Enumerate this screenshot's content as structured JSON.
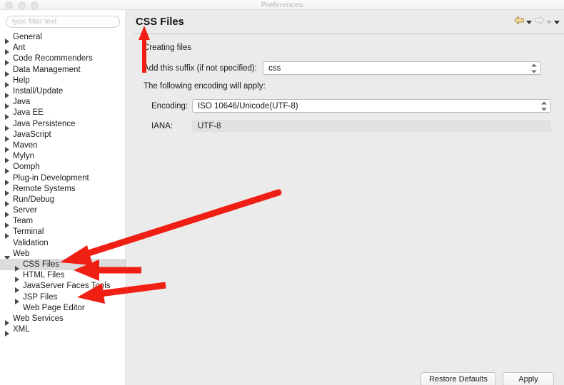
{
  "window": {
    "title": "Preferences",
    "traffic_lights": [
      "close-button",
      "minimize-button",
      "zoom-button"
    ]
  },
  "sidebar": {
    "filter": {
      "placeholder": "type filter text",
      "value": ""
    },
    "items": [
      {
        "label": "General",
        "level": 1,
        "twisty": "collapsed",
        "selected": false
      },
      {
        "label": "Ant",
        "level": 1,
        "twisty": "collapsed",
        "selected": false
      },
      {
        "label": "Code Recommenders",
        "level": 1,
        "twisty": "collapsed",
        "selected": false
      },
      {
        "label": "Data Management",
        "level": 1,
        "twisty": "collapsed",
        "selected": false
      },
      {
        "label": "Help",
        "level": 1,
        "twisty": "collapsed",
        "selected": false
      },
      {
        "label": "Install/Update",
        "level": 1,
        "twisty": "collapsed",
        "selected": false
      },
      {
        "label": "Java",
        "level": 1,
        "twisty": "collapsed",
        "selected": false
      },
      {
        "label": "Java EE",
        "level": 1,
        "twisty": "collapsed",
        "selected": false
      },
      {
        "label": "Java Persistence",
        "level": 1,
        "twisty": "collapsed",
        "selected": false
      },
      {
        "label": "JavaScript",
        "level": 1,
        "twisty": "collapsed",
        "selected": false
      },
      {
        "label": "Maven",
        "level": 1,
        "twisty": "collapsed",
        "selected": false
      },
      {
        "label": "Mylyn",
        "level": 1,
        "twisty": "collapsed",
        "selected": false
      },
      {
        "label": "Oomph",
        "level": 1,
        "twisty": "collapsed",
        "selected": false
      },
      {
        "label": "Plug-in Development",
        "level": 1,
        "twisty": "collapsed",
        "selected": false
      },
      {
        "label": "Remote Systems",
        "level": 1,
        "twisty": "collapsed",
        "selected": false
      },
      {
        "label": "Run/Debug",
        "level": 1,
        "twisty": "collapsed",
        "selected": false
      },
      {
        "label": "Server",
        "level": 1,
        "twisty": "collapsed",
        "selected": false
      },
      {
        "label": "Team",
        "level": 1,
        "twisty": "collapsed",
        "selected": false
      },
      {
        "label": "Terminal",
        "level": 1,
        "twisty": "collapsed",
        "selected": false
      },
      {
        "label": "Validation",
        "level": 1,
        "twisty": "none",
        "selected": false
      },
      {
        "label": "Web",
        "level": 1,
        "twisty": "expanded",
        "selected": false
      },
      {
        "label": "CSS Files",
        "level": 2,
        "twisty": "collapsed",
        "selected": true
      },
      {
        "label": "HTML Files",
        "level": 2,
        "twisty": "collapsed",
        "selected": false
      },
      {
        "label": "JavaServer Faces Tools",
        "level": 2,
        "twisty": "collapsed",
        "selected": false
      },
      {
        "label": "JSP Files",
        "level": 2,
        "twisty": "collapsed",
        "selected": false
      },
      {
        "label": "Web Page Editor",
        "level": 2,
        "twisty": "none",
        "selected": false
      },
      {
        "label": "Web Services",
        "level": 1,
        "twisty": "collapsed",
        "selected": false
      },
      {
        "label": "XML",
        "level": 1,
        "twisty": "collapsed",
        "selected": false
      }
    ]
  },
  "panel": {
    "title": "CSS Files",
    "nav": {
      "back_label": "back-arrow",
      "forward_label": "forward-icon",
      "menu_label": "view-menu"
    },
    "section_title": "Creating files",
    "suffix": {
      "label": "Add this suffix (if not specified):",
      "value": "css"
    },
    "encoding_note": "The following encoding will apply:",
    "encoding": {
      "label": "Encoding:",
      "value": "ISO 10646/Unicode(UTF-8)"
    },
    "iana": {
      "label": "IANA:",
      "value": "UTF-8"
    }
  },
  "footer": {
    "restore_defaults_label": "Restore Defaults",
    "apply_label": "Apply"
  },
  "colors": {
    "annotation_red": "#f01f14",
    "panel_background": "#ebebeb",
    "sidebar_background": "#ffffff",
    "selection_gray": "#dcdcdc",
    "back_arrow_yellow": "#e8c77a"
  },
  "annotations": [
    {
      "name": "arrow-to-panel-title",
      "direction": "up"
    },
    {
      "name": "arrow-to-css-files",
      "direction": "left-diagonal"
    },
    {
      "name": "arrow-to-html-files",
      "direction": "left"
    },
    {
      "name": "arrow-to-jsp-files",
      "direction": "left"
    }
  ]
}
